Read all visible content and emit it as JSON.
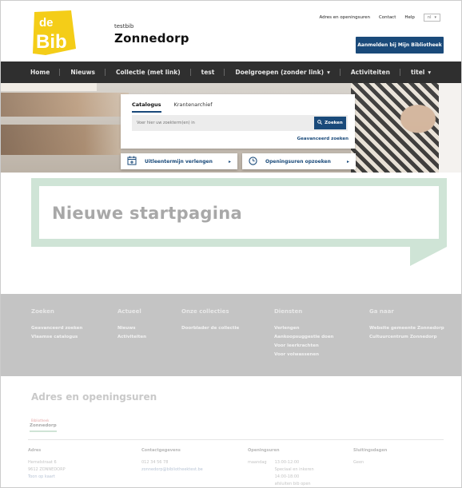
{
  "header": {
    "subtitle": "testbib",
    "title": "Zonnedorp",
    "logo_text_top": "de",
    "logo_text_bottom": "Bib",
    "top_links": [
      "Adres en openingsuren",
      "Contact",
      "Help"
    ],
    "language": "nl",
    "login_label": "Aanmelden bij Mijn Bibliotheek"
  },
  "nav": {
    "items": [
      {
        "label": "Home",
        "dropdown": false
      },
      {
        "label": "Nieuws",
        "dropdown": false
      },
      {
        "label": "Collectie (met link)",
        "dropdown": false
      },
      {
        "label": "test",
        "dropdown": false
      },
      {
        "label": "Doelgroepen (zonder link)",
        "dropdown": true
      },
      {
        "label": "Activiteiten",
        "dropdown": false
      },
      {
        "label": "titel",
        "dropdown": true
      }
    ]
  },
  "search": {
    "tabs": [
      "Catalogus",
      "Krantenarchief"
    ],
    "active_tab": "Catalogus",
    "placeholder": "Voer hier uw zoekterm(en) in",
    "button_label": "Zoeken",
    "advanced_label": "Geavanceerd zoeken"
  },
  "quick_links": [
    {
      "label": "Uitleentermijn verlengen",
      "icon": "calendar-plus-icon"
    },
    {
      "label": "Openingsuren opzoeken",
      "icon": "clock-icon"
    }
  ],
  "banner": {
    "title": "Nieuwe startpagina"
  },
  "footer": {
    "columns": [
      {
        "heading": "Zoeken",
        "links": [
          "Geavanceerd zoeken",
          "Vlaamse catalogus"
        ]
      },
      {
        "heading": "Actueel",
        "links": [
          "Nieuws",
          "Activiteiten"
        ]
      },
      {
        "heading": "Onze collecties",
        "links": [
          "Doorblader de collectie"
        ]
      },
      {
        "heading": "Diensten",
        "links": [
          "Verlengen",
          "Aankoopsuggestie doen",
          "Voor leerkrachten",
          "Voor volwassenen"
        ]
      },
      {
        "heading": "Ga naar",
        "links": [
          "Website gemeente Zonnedorp",
          "Cultuurcentrum Zonnedorp"
        ]
      }
    ]
  },
  "address": {
    "title": "Adres en openingsuren",
    "location_label": "Bibliotheek",
    "location_name": "Zonnedorp",
    "cols": {
      "adres_heading": "Adres",
      "adres_lines": [
        "Hemelstraat 6",
        "9612 ZONNEDORP",
        "Toon op kaart"
      ],
      "contact_heading": "Contactgegevens",
      "contact_lines": [
        "012 34 56 78",
        "zonnedorp@bibliotheektest.be"
      ],
      "hours_heading": "Openingsuren",
      "hours_day": "maandag",
      "hours_lines": [
        "13:00-12:00",
        "Speciaal en inkeren",
        "14:00-18:00",
        "afsluiten bib open"
      ],
      "closing_heading": "Sluitingsdagen",
      "closing_lines": [
        "Geen"
      ]
    }
  },
  "colors": {
    "brand_blue": "#1a4a7a",
    "nav_bg": "#2f2f2f",
    "logo_yellow": "#f4cd18",
    "banner_green": "#cfe4d6",
    "footer_grey": "#c4c4c4"
  }
}
